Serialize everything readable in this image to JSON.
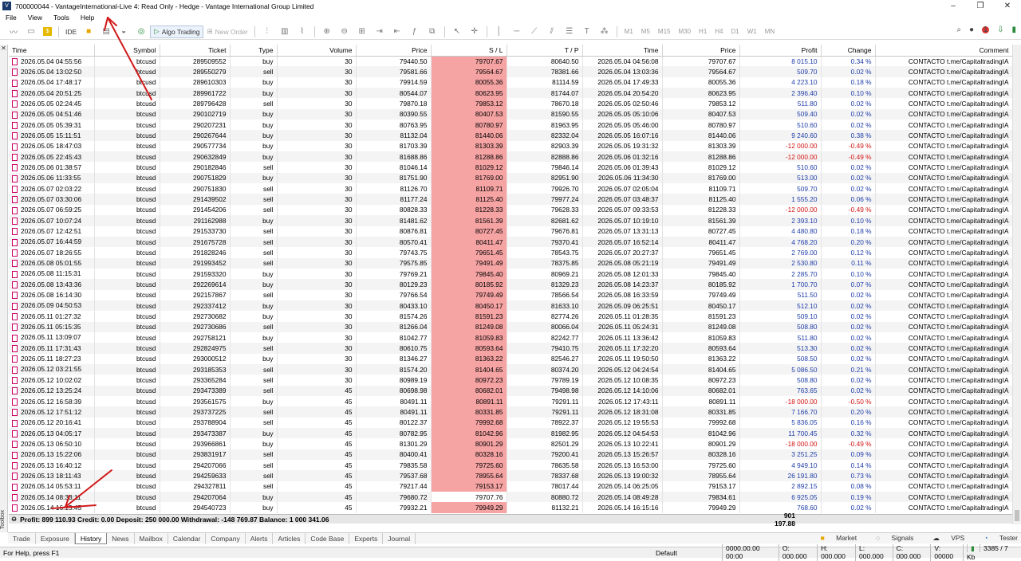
{
  "title": "700000044 - VantageInternational-Live 4: Read Only - Hedge - Vantage International Group Limited",
  "menu": [
    "File",
    "View",
    "Tools",
    "Help"
  ],
  "toolbar": {
    "ide": "IDE",
    "algo_trading": "Algo Trading",
    "new_order": "New Order",
    "timeframes": [
      "M1",
      "M5",
      "M15",
      "M30",
      "H1",
      "H4",
      "D1",
      "W1",
      "MN"
    ],
    "notification_count": "1"
  },
  "columns": [
    "Time",
    "Symbol",
    "Ticket",
    "Type",
    "Volume",
    "Price",
    "S / L",
    "T / P",
    "Time",
    "Price",
    "Profit",
    "Change",
    "Comment"
  ],
  "rows": [
    [
      "2026.05.04 04:55:56",
      "btcusd",
      "289509552",
      "buy",
      "30",
      "79440.50",
      "79707.67",
      "80640.50",
      "2026.05.04 04:56:08",
      "79707.67",
      "8 015.10",
      "0.34 %",
      "CONTACTO t.me/CapitaltradingIA"
    ],
    [
      "2026.05.04 13:02:50",
      "btcusd",
      "289550279",
      "sell",
      "30",
      "79581.66",
      "79564.67",
      "78381.66",
      "2026.05.04 13:03:36",
      "79564.67",
      "509.70",
      "0.02 %",
      "CONTACTO t.me/CapitaltradingIA"
    ],
    [
      "2026.05.04 17:48:17",
      "btcusd",
      "289610303",
      "buy",
      "30",
      "79914.59",
      "80055.36",
      "81114.59",
      "2026.05.04 17:49:33",
      "80055.36",
      "4 223.10",
      "0.18 %",
      "CONTACTO t.me/CapitaltradingIA"
    ],
    [
      "2026.05.04 20:51:25",
      "btcusd",
      "289961722",
      "buy",
      "30",
      "80544.07",
      "80623.95",
      "81744.07",
      "2026.05.04 20:54:20",
      "80623.95",
      "2 396.40",
      "0.10 %",
      "CONTACTO t.me/CapitaltradingIA"
    ],
    [
      "2026.05.05 02:24:45",
      "btcusd",
      "289796428",
      "sell",
      "30",
      "79870.18",
      "79853.12",
      "78670.18",
      "2026.05.05 02:50:46",
      "79853.12",
      "511.80",
      "0.02 %",
      "CONTACTO t.me/CapitaltradingIA"
    ],
    [
      "2026.05.05 04:51:46",
      "btcusd",
      "290102719",
      "buy",
      "30",
      "80390.55",
      "80407.53",
      "81590.55",
      "2026.05.05 05:10:06",
      "80407.53",
      "509.40",
      "0.02 %",
      "CONTACTO t.me/CapitaltradingIA"
    ],
    [
      "2026.05.05 05:39:31",
      "btcusd",
      "290207231",
      "buy",
      "30",
      "80763.95",
      "80780.97",
      "81963.95",
      "2026.05.05 05:46:00",
      "80780.97",
      "510.60",
      "0.02 %",
      "CONTACTO t.me/CapitaltradingIA"
    ],
    [
      "2026.05.05 15:11:51",
      "btcusd",
      "290267644",
      "buy",
      "30",
      "81132.04",
      "81440.06",
      "82332.04",
      "2026.05.05 16:07:16",
      "81440.06",
      "9 240.60",
      "0.38 %",
      "CONTACTO t.me/CapitaltradingIA"
    ],
    [
      "2026.05.05 18:47:03",
      "btcusd",
      "290577734",
      "buy",
      "30",
      "81703.39",
      "81303.39",
      "82903.39",
      "2026.05.05 19:31:32",
      "81303.39",
      "-12 000.00",
      "-0.49 %",
      "CONTACTO t.me/CapitaltradingIA"
    ],
    [
      "2026.05.05 22:45:43",
      "btcusd",
      "290632849",
      "buy",
      "30",
      "81688.86",
      "81288.86",
      "82888.86",
      "2026.05.06 01:32:16",
      "81288.86",
      "-12 000.00",
      "-0.49 %",
      "CONTACTO t.me/CapitaltradingIA"
    ],
    [
      "2026.05.06 01:38:57",
      "btcusd",
      "290182846",
      "sell",
      "30",
      "81046.14",
      "81029.12",
      "79846.14",
      "2026.05.06 01:39:43",
      "81029.12",
      "510.60",
      "0.02 %",
      "CONTACTO t.me/CapitaltradingIA"
    ],
    [
      "2026.05.06 11:33:55",
      "btcusd",
      "290751829",
      "buy",
      "30",
      "81751.90",
      "81769.00",
      "82951.90",
      "2026.05.06 11:34:30",
      "81769.00",
      "513.00",
      "0.02 %",
      "CONTACTO t.me/CapitaltradingIA"
    ],
    [
      "2026.05.07 02:03:22",
      "btcusd",
      "290751830",
      "sell",
      "30",
      "81126.70",
      "81109.71",
      "79926.70",
      "2026.05.07 02:05:04",
      "81109.71",
      "509.70",
      "0.02 %",
      "CONTACTO t.me/CapitaltradingIA"
    ],
    [
      "2026.05.07 03:30:06",
      "btcusd",
      "291439502",
      "sell",
      "30",
      "81177.24",
      "81125.40",
      "79977.24",
      "2026.05.07 03:48:37",
      "81125.40",
      "1 555.20",
      "0.06 %",
      "CONTACTO t.me/CapitaltradingIA"
    ],
    [
      "2026.05.07 06:59:25",
      "btcusd",
      "291454206",
      "sell",
      "30",
      "80828.33",
      "81228.33",
      "79628.33",
      "2026.05.07 09:33:53",
      "81228.33",
      "-12 000.00",
      "-0.49 %",
      "CONTACTO t.me/CapitaltradingIA"
    ],
    [
      "2026.05.07 10:07:24",
      "btcusd",
      "291162988",
      "buy",
      "30",
      "81481.62",
      "81561.39",
      "82681.62",
      "2026.05.07 10:19:10",
      "81561.39",
      "2 393.10",
      "0.10 %",
      "CONTACTO t.me/CapitaltradingIA"
    ],
    [
      "2026.05.07 12:42:51",
      "btcusd",
      "291533730",
      "sell",
      "30",
      "80876.81",
      "80727.45",
      "79676.81",
      "2026.05.07 13:31:13",
      "80727.45",
      "4 480.80",
      "0.18 %",
      "CONTACTO t.me/CapitaltradingIA"
    ],
    [
      "2026.05.07 16:44:59",
      "btcusd",
      "291675728",
      "sell",
      "30",
      "80570.41",
      "80411.47",
      "79370.41",
      "2026.05.07 16:52:14",
      "80411.47",
      "4 768.20",
      "0.20 %",
      "CONTACTO t.me/CapitaltradingIA"
    ],
    [
      "2026.05.07 18:26:55",
      "btcusd",
      "291828246",
      "sell",
      "30",
      "79743.75",
      "79651.45",
      "78543.75",
      "2026.05.07 20:27:37",
      "79651.45",
      "2 769.00",
      "0.12 %",
      "CONTACTO t.me/CapitaltradingIA"
    ],
    [
      "2026.05.08 05:01:55",
      "btcusd",
      "291993452",
      "sell",
      "30",
      "79575.85",
      "79491.49",
      "78375.85",
      "2026.05.08 05:21:19",
      "79491.49",
      "2 530.80",
      "0.11 %",
      "CONTACTO t.me/CapitaltradingIA"
    ],
    [
      "2026.05.08 11:15:31",
      "btcusd",
      "291593320",
      "buy",
      "30",
      "79769.21",
      "79845.40",
      "80969.21",
      "2026.05.08 12:01:33",
      "79845.40",
      "2 285.70",
      "0.10 %",
      "CONTACTO t.me/CapitaltradingIA"
    ],
    [
      "2026.05.08 13:43:36",
      "btcusd",
      "292269614",
      "buy",
      "30",
      "80129.23",
      "80185.92",
      "81329.23",
      "2026.05.08 14:23:37",
      "80185.92",
      "1 700.70",
      "0.07 %",
      "CONTACTO t.me/CapitaltradingIA"
    ],
    [
      "2026.05.08 16:14:30",
      "btcusd",
      "292157867",
      "sell",
      "30",
      "79766.54",
      "79749.49",
      "78566.54",
      "2026.05.08 16:33:59",
      "79749.49",
      "511.50",
      "0.02 %",
      "CONTACTO t.me/CapitaltradingIA"
    ],
    [
      "2026.05.09 04:50:53",
      "btcusd",
      "292337412",
      "buy",
      "30",
      "80433.10",
      "80450.17",
      "81633.10",
      "2026.05.09 06:25:51",
      "80450.17",
      "512.10",
      "0.02 %",
      "CONTACTO t.me/CapitaltradingIA"
    ],
    [
      "2026.05.11 01:27:32",
      "btcusd",
      "292730682",
      "buy",
      "30",
      "81574.26",
      "81591.23",
      "82774.26",
      "2026.05.11 01:28:35",
      "81591.23",
      "509.10",
      "0.02 %",
      "CONTACTO t.me/CapitaltradingIA"
    ],
    [
      "2026.05.11 05:15:35",
      "btcusd",
      "292730686",
      "sell",
      "30",
      "81266.04",
      "81249.08",
      "80066.04",
      "2026.05.11 05:24:31",
      "81249.08",
      "508.80",
      "0.02 %",
      "CONTACTO t.me/CapitaltradingIA"
    ],
    [
      "2026.05.11 13:09:07",
      "btcusd",
      "292758121",
      "buy",
      "30",
      "81042.77",
      "81059.83",
      "82242.77",
      "2026.05.11 13:36:42",
      "81059.83",
      "511.80",
      "0.02 %",
      "CONTACTO t.me/CapitaltradingIA"
    ],
    [
      "2026.05.11 17:31:43",
      "btcusd",
      "292824975",
      "sell",
      "30",
      "80610.75",
      "80593.64",
      "79410.75",
      "2026.05.11 17:32:20",
      "80593.64",
      "513.30",
      "0.02 %",
      "CONTACTO t.me/CapitaltradingIA"
    ],
    [
      "2026.05.11 18:27:23",
      "btcusd",
      "293000512",
      "buy",
      "30",
      "81346.27",
      "81363.22",
      "82546.27",
      "2026.05.11 19:50:50",
      "81363.22",
      "508.50",
      "0.02 %",
      "CONTACTO t.me/CapitaltradingIA"
    ],
    [
      "2026.05.12 03:21:55",
      "btcusd",
      "293185353",
      "sell",
      "30",
      "81574.20",
      "81404.65",
      "80374.20",
      "2026.05.12 04:24:54",
      "81404.65",
      "5 086.50",
      "0.21 %",
      "CONTACTO t.me/CapitaltradingIA"
    ],
    [
      "2026.05.12 10:02:02",
      "btcusd",
      "293365284",
      "sell",
      "30",
      "80989.19",
      "80972.23",
      "79789.19",
      "2026.05.12 10:08:35",
      "80972.23",
      "508.80",
      "0.02 %",
      "CONTACTO t.me/CapitaltradingIA"
    ],
    [
      "2026.05.12 13:25:24",
      "btcusd",
      "293473389",
      "sell",
      "45",
      "80698.98",
      "80682.01",
      "79498.98",
      "2026.05.12 14:10:06",
      "80682.01",
      "763.65",
      "0.02 %",
      "CONTACTO t.me/CapitaltradingIA"
    ],
    [
      "2026.05.12 16:58:39",
      "btcusd",
      "293561575",
      "buy",
      "45",
      "80491.11",
      "80891.11",
      "79291.11",
      "2026.05.12 17:43:11",
      "80891.11",
      "-18 000.00",
      "-0.50 %",
      "CONTACTO t.me/CapitaltradingIA"
    ],
    [
      "2026.05.12 17:51:12",
      "btcusd",
      "293737225",
      "sell",
      "45",
      "80491.11",
      "80331.85",
      "79291.11",
      "2026.05.12 18:31:08",
      "80331.85",
      "7 166.70",
      "0.20 %",
      "CONTACTO t.me/CapitaltradingIA"
    ],
    [
      "2026.05.12 20:16:41",
      "btcusd",
      "293788904",
      "sell",
      "45",
      "80122.37",
      "79992.68",
      "78922.37",
      "2026.05.12 19:55:53",
      "79992.68",
      "5 836.05",
      "0.16 %",
      "CONTACTO t.me/CapitaltradingIA"
    ],
    [
      "2026.05.13 04:05:17",
      "btcusd",
      "293473387",
      "buy",
      "45",
      "80782.95",
      "81042.96",
      "81982.95",
      "2026.05.12 04:54:53",
      "81042.96",
      "11 700.45",
      "0.32 %",
      "CONTACTO t.me/CapitaltradingIA"
    ],
    [
      "2026.05.13 06:50:10",
      "btcusd",
      "293966861",
      "buy",
      "45",
      "81301.29",
      "80901.29",
      "82501.29",
      "2026.05.13 10:22:41",
      "80901.29",
      "-18 000.00",
      "-0.49 %",
      "CONTACTO t.me/CapitaltradingIA"
    ],
    [
      "2026.05.13 15:22:06",
      "btcusd",
      "293831917",
      "sell",
      "45",
      "80400.41",
      "80328.16",
      "79200.41",
      "2026.05.13 15:26:57",
      "80328.16",
      "3 251.25",
      "0.09 %",
      "CONTACTO t.me/CapitaltradingIA"
    ],
    [
      "2026.05.13 16:40:12",
      "btcusd",
      "294207066",
      "sell",
      "45",
      "79835.58",
      "79725.60",
      "78635.58",
      "2026.05.13 16:53:00",
      "79725.60",
      "4 949.10",
      "0.14 %",
      "CONTACTO t.me/CapitaltradingIA"
    ],
    [
      "2026.05.13 18:11:43",
      "btcusd",
      "294259633",
      "sell",
      "45",
      "79537.68",
      "78955.64",
      "78337.68",
      "2026.05.13 19:00:32",
      "78955.64",
      "26 191.80",
      "0.73 %",
      "CONTACTO t.me/CapitaltradingIA"
    ],
    [
      "2026.05.14 05:53:11",
      "btcusd",
      "294327811",
      "sell",
      "45",
      "79217.44",
      "79153.17",
      "78017.44",
      "2026.05.14 06:25:05",
      "79153.17",
      "2 892.15",
      "0.08 %",
      "CONTACTO t.me/CapitaltradingIA"
    ],
    [
      "2026.05.14 08:33:11",
      "btcusd",
      "294207064",
      "buy",
      "45",
      "79680.72",
      "79707.76",
      "80880.72",
      "2026.05.14 08:49:28",
      "79834.61",
      "6 925.05",
      "0.19 %",
      "CONTACTO t.me/CapitaltradingIA"
    ],
    [
      "2026.05.14 16:15:45",
      "btcusd",
      "294540723",
      "buy",
      "45",
      "79932.21",
      "79949.29",
      "81132.21",
      "2026.05.14 16:15:16",
      "79949.29",
      "768.60",
      "0.02 %",
      "CONTACTO t.me/CapitaltradingIA"
    ]
  ],
  "summary": {
    "text": "Profit: 899 110.93  Credit: 0.00  Deposit: 250 000.00  Withdrawal: -148 769.87  Balance: 1 000 341.06",
    "total_profit": "901 197.88"
  },
  "toolbox_label": "Toolbox",
  "tabs": [
    "Trade",
    "Exposure",
    "History",
    "News",
    "Mailbox",
    "Calendar",
    "Company",
    "Alerts",
    "Articles",
    "Code Base",
    "Experts",
    "Journal"
  ],
  "active_tab": "History",
  "tabs_right": [
    "Market",
    "Signals",
    "VPS",
    "Tester"
  ],
  "status": {
    "help": "For Help, press F1",
    "profile": "Default",
    "cells": [
      "0000.00.00 00:00",
      "O: 000.000",
      "H: 000.000",
      "L: 000.000",
      "C: 000.000",
      "V: 00000",
      "3385 / 7 Kb"
    ]
  },
  "colors": {
    "sl_highlight": "#f6a3a3",
    "profit_positive": "#1f3ea8",
    "profit_negative": "#d41414",
    "annotation_arrow": "#d11a1a"
  }
}
